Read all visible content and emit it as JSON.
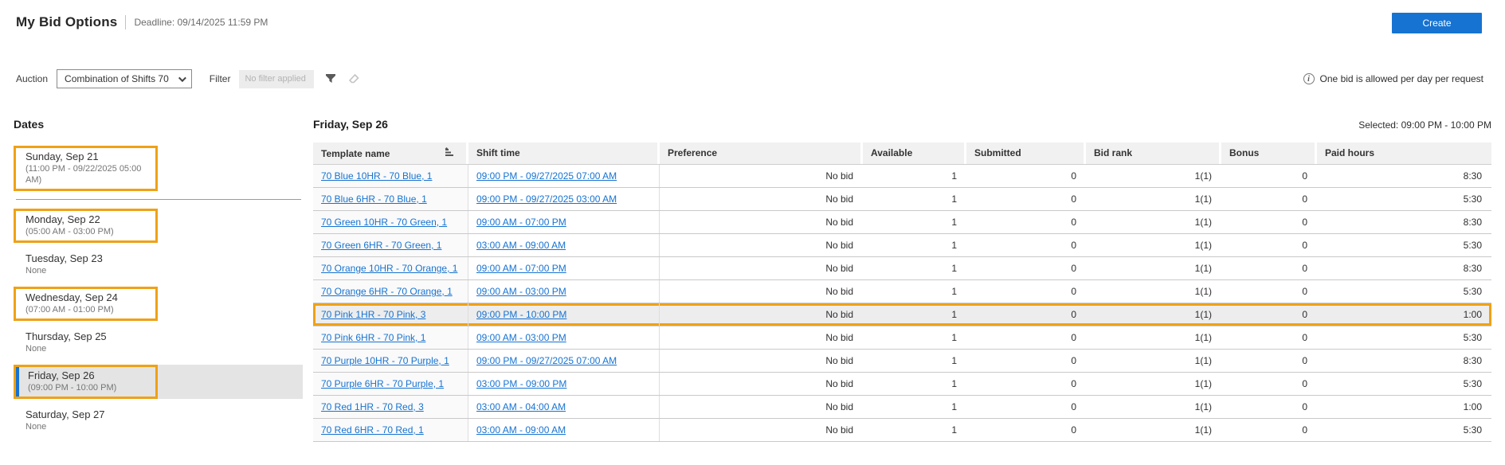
{
  "header": {
    "title": "My Bid Options",
    "deadline": "Deadline: 09/14/2025 11:59 PM",
    "create_label": "Create"
  },
  "toolbar": {
    "auction_label": "Auction",
    "auction_value": "Combination of Shifts 70",
    "filter_label": "Filter",
    "filter_value": "No filter applied",
    "icons": [
      "funnel-filter-icon",
      "eraser-clear-filter-icon",
      "info-circle-icon",
      "sort-icon",
      "chevron-down-icon"
    ],
    "info_text": "One bid is allowed per day per request"
  },
  "sidebar": {
    "heading": "Dates",
    "items": [
      {
        "title": "Sunday, Sep 21",
        "sub": "(11:00 PM - 09/22/2025 05:00 AM)",
        "highlighted": true,
        "selected": false,
        "divider_after": true
      },
      {
        "title": "Monday, Sep 22",
        "sub": "(05:00 AM - 03:00 PM)",
        "highlighted": true,
        "selected": false,
        "divider_after": false
      },
      {
        "title": "Tuesday, Sep 23",
        "sub": "None",
        "highlighted": false,
        "selected": false,
        "divider_after": false
      },
      {
        "title": "Wednesday, Sep 24",
        "sub": "(07:00 AM - 01:00 PM)",
        "highlighted": true,
        "selected": false,
        "divider_after": false
      },
      {
        "title": "Thursday, Sep 25",
        "sub": "None",
        "highlighted": false,
        "selected": false,
        "divider_after": false
      },
      {
        "title": "Friday, Sep 26",
        "sub": "(09:00 PM - 10:00 PM)",
        "highlighted": true,
        "selected": true,
        "divider_after": false
      },
      {
        "title": "Saturday, Sep 27",
        "sub": "None",
        "highlighted": false,
        "selected": false,
        "divider_after": false
      }
    ]
  },
  "main": {
    "heading": "Friday, Sep 26",
    "selected_info": "Selected: 09:00 PM - 10:00 PM",
    "table": {
      "columns": [
        "Template name",
        "Shift time",
        "Preference",
        "Available",
        "Submitted",
        "Bid rank",
        "Bonus",
        "Paid hours"
      ],
      "rows": [
        {
          "template": "70 Blue 10HR - 70 Blue, 1",
          "shift": "09:00 PM - 09/27/2025 07:00 AM",
          "preference": "No bid",
          "available": "1",
          "submitted": "0",
          "bid_rank": "1(1)",
          "bonus": "0",
          "paid_hours": "8:30",
          "highlighted": false
        },
        {
          "template": "70 Blue 6HR - 70 Blue, 1",
          "shift": "09:00 PM - 09/27/2025 03:00 AM",
          "preference": "No bid",
          "available": "1",
          "submitted": "0",
          "bid_rank": "1(1)",
          "bonus": "0",
          "paid_hours": "5:30",
          "highlighted": false
        },
        {
          "template": "70 Green 10HR - 70 Green, 1",
          "shift": "09:00 AM - 07:00 PM",
          "preference": "No bid",
          "available": "1",
          "submitted": "0",
          "bid_rank": "1(1)",
          "bonus": "0",
          "paid_hours": "8:30",
          "highlighted": false
        },
        {
          "template": "70 Green 6HR - 70 Green, 1",
          "shift": "03:00 AM - 09:00 AM",
          "preference": "No bid",
          "available": "1",
          "submitted": "0",
          "bid_rank": "1(1)",
          "bonus": "0",
          "paid_hours": "5:30",
          "highlighted": false
        },
        {
          "template": "70 Orange 10HR - 70 Orange, 1",
          "shift": "09:00 AM - 07:00 PM",
          "preference": "No bid",
          "available": "1",
          "submitted": "0",
          "bid_rank": "1(1)",
          "bonus": "0",
          "paid_hours": "8:30",
          "highlighted": false
        },
        {
          "template": "70 Orange 6HR - 70 Orange, 1",
          "shift": "09:00 AM - 03:00 PM",
          "preference": "No bid",
          "available": "1",
          "submitted": "0",
          "bid_rank": "1(1)",
          "bonus": "0",
          "paid_hours": "5:30",
          "highlighted": false
        },
        {
          "template": "70 Pink 1HR - 70 Pink, 3",
          "shift": "09:00 PM - 10:00 PM",
          "preference": "No bid",
          "available": "1",
          "submitted": "0",
          "bid_rank": "1(1)",
          "bonus": "0",
          "paid_hours": "1:00",
          "highlighted": true
        },
        {
          "template": "70 Pink 6HR - 70 Pink, 1",
          "shift": "09:00 AM - 03:00 PM",
          "preference": "No bid",
          "available": "1",
          "submitted": "0",
          "bid_rank": "1(1)",
          "bonus": "0",
          "paid_hours": "5:30",
          "highlighted": false
        },
        {
          "template": "70 Purple 10HR - 70 Purple, 1",
          "shift": "09:00 PM - 09/27/2025 07:00 AM",
          "preference": "No bid",
          "available": "1",
          "submitted": "0",
          "bid_rank": "1(1)",
          "bonus": "0",
          "paid_hours": "8:30",
          "highlighted": false
        },
        {
          "template": "70 Purple 6HR - 70 Purple, 1",
          "shift": "03:00 PM - 09:00 PM",
          "preference": "No bid",
          "available": "1",
          "submitted": "0",
          "bid_rank": "1(1)",
          "bonus": "0",
          "paid_hours": "5:30",
          "highlighted": false
        },
        {
          "template": "70 Red 1HR - 70 Red, 3",
          "shift": "03:00 AM - 04:00 AM",
          "preference": "No bid",
          "available": "1",
          "submitted": "0",
          "bid_rank": "1(1)",
          "bonus": "0",
          "paid_hours": "1:00",
          "highlighted": false
        },
        {
          "template": "70 Red 6HR - 70 Red, 1",
          "shift": "03:00 AM - 09:00 AM",
          "preference": "No bid",
          "available": "1",
          "submitted": "0",
          "bid_rank": "1(1)",
          "bonus": "0",
          "paid_hours": "5:30",
          "highlighted": false
        }
      ]
    }
  },
  "colors": {
    "accent_blue": "#1673d2",
    "link_blue": "#1673d2",
    "highlight_orange": "#efa116",
    "selected_date_bg": "#e4e4e4",
    "table_header_bg": "#f1f1f1"
  }
}
